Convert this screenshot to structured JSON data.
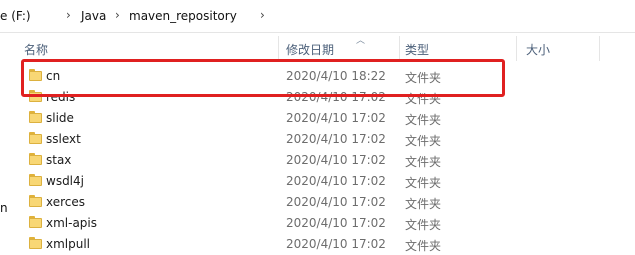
{
  "breadcrumb": {
    "drive_fragment": "e (F:)",
    "items": [
      "Java",
      "maven_repository"
    ]
  },
  "nav": {
    "fragment": "n"
  },
  "columns": {
    "name": "名称",
    "date": "修改日期",
    "type": "类型",
    "size": "大小"
  },
  "rows": [
    {
      "name": "cn",
      "date": "2020/4/10 18:22",
      "type": "文件夹"
    },
    {
      "name": "redis",
      "date": "2020/4/10 17:02",
      "type": "文件夹"
    },
    {
      "name": "slide",
      "date": "2020/4/10 17:02",
      "type": "文件夹"
    },
    {
      "name": "sslext",
      "date": "2020/4/10 17:02",
      "type": "文件夹"
    },
    {
      "name": "stax",
      "date": "2020/4/10 17:02",
      "type": "文件夹"
    },
    {
      "name": "wsdl4j",
      "date": "2020/4/10 17:02",
      "type": "文件夹"
    },
    {
      "name": "xerces",
      "date": "2020/4/10 17:02",
      "type": "文件夹"
    },
    {
      "name": "xml-apis",
      "date": "2020/4/10 17:02",
      "type": "文件夹"
    },
    {
      "name": "xmlpull",
      "date": "2020/4/10 17:02",
      "type": "文件夹"
    }
  ],
  "colors": {
    "highlight": "#e02020",
    "folder": "#f8d775",
    "header_text": "#4c607a"
  }
}
